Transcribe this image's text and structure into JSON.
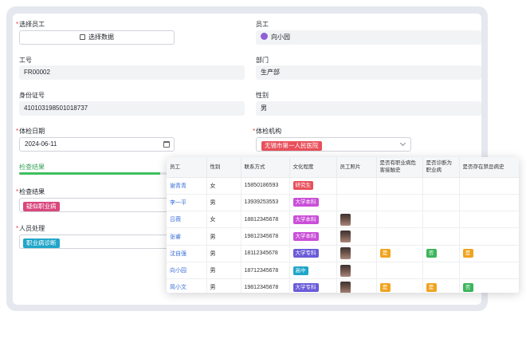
{
  "form": {
    "select_employee_label": "选择员工",
    "select_data_button": "选择数据",
    "employee_label": "员工",
    "employee_value": "向小园",
    "job_no_label": "工号",
    "job_no_value": "FR00002",
    "department_label": "部门",
    "department_value": "生产部",
    "id_card_label": "身份证号",
    "id_card_value": "410103198501018737",
    "gender_label": "性别",
    "gender_value": "男",
    "exam_date_label": "体检日期",
    "exam_date_value": "2024-06-11",
    "exam_org_label": "体检机构",
    "exam_org_value": "无锡市第一人民医院",
    "result_section_title": "检查结果",
    "result_progress": 0.95,
    "exam_result_label": "检查结果",
    "exam_result_value": "疑似职业病",
    "handling_label": "人员处理",
    "handling_value": "职业病诊断"
  },
  "table": {
    "headers": [
      "员工",
      "性别",
      "联系方式",
      "文化程度",
      "员工照片",
      "是否有职业病危害接触史",
      "是否诊断为职业病",
      "是否存在禁忌病史"
    ],
    "rows": [
      {
        "name": "谢青青",
        "gender": "女",
        "phone": "15850186593",
        "edu": "研究生",
        "edu_color": "#e8505b",
        "photo": false,
        "c1": "",
        "c2": "",
        "c3": ""
      },
      {
        "name": "李一平",
        "gender": "男",
        "phone": "13939253553",
        "edu": "大学本科",
        "edu_color": "#c94fd8",
        "photo": false,
        "c1": "",
        "c2": "",
        "c3": ""
      },
      {
        "name": "吕薇",
        "gender": "女",
        "phone": "18812345678",
        "edu": "大学本科",
        "edu_color": "#c94fd8",
        "photo": true,
        "c1": "",
        "c2": "",
        "c3": ""
      },
      {
        "name": "张睿",
        "gender": "男",
        "phone": "19812345678",
        "edu": "大学本科",
        "edu_color": "#c94fd8",
        "photo": true,
        "c1": "",
        "c2": "",
        "c3": ""
      },
      {
        "name": "沈自强",
        "gender": "男",
        "phone": "18112345678",
        "edu": "大学专科",
        "edu_color": "#6a5cd8",
        "photo": true,
        "c1": "是",
        "c2": "否",
        "c3": "是"
      },
      {
        "name": "向小园",
        "gender": "男",
        "phone": "18712345678",
        "edu": "高中",
        "edu_color": "#1fa6c9",
        "photo": true,
        "c1": "",
        "c2": "",
        "c3": ""
      },
      {
        "name": "简小文",
        "gender": "男",
        "phone": "19812345678",
        "edu": "大学专科",
        "edu_color": "#6a5cd8",
        "photo": true,
        "c1": "是",
        "c2": "是",
        "c3": "否"
      }
    ]
  },
  "colors": {
    "yes": "#f0a320",
    "no": "#3cb55b",
    "accent_link": "#3a6fd8",
    "required": "#e8453c"
  }
}
